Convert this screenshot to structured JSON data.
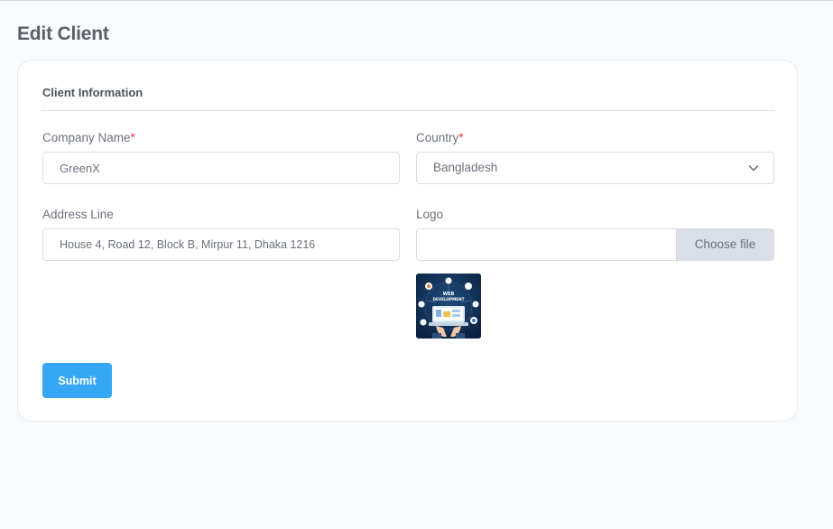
{
  "page": {
    "title": "Edit Client"
  },
  "form": {
    "section_title": "Client Information",
    "company_name": {
      "label": "Company Name",
      "required_mark": "*",
      "value": "GreenX"
    },
    "country": {
      "label": "Country",
      "required_mark": "*",
      "selected": "Bangladesh"
    },
    "address_line": {
      "label": "Address Line",
      "value": "House 4, Road 12, Block B, Mirpur 11, Dhaka 1216"
    },
    "logo": {
      "label": "Logo",
      "button_label": "Choose file",
      "preview_text_line1": "WEB",
      "preview_text_line2": "DEVELOPMENT"
    },
    "submit_label": "Submit"
  },
  "colors": {
    "accent": "#36a7f5",
    "required": "#e2343b",
    "background": "#f8fbfd"
  },
  "icons": {
    "country_dropdown": "chevron-down-icon"
  }
}
